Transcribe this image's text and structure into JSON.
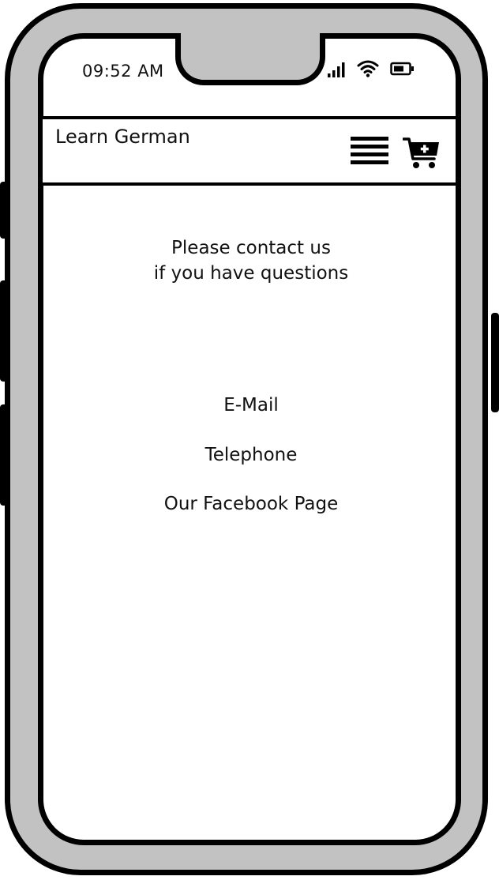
{
  "status_bar": {
    "time": "09:52 AM",
    "icons": [
      "signal-icon",
      "wifi-icon",
      "battery-icon"
    ]
  },
  "header": {
    "title": "Learn German",
    "menu_icon": "hamburger-menu-icon",
    "cart_icon": "add-to-cart-icon"
  },
  "contact": {
    "intro_line1": "Please contact us",
    "intro_line2": "if you have questions",
    "links": {
      "email": "E-Mail",
      "telephone": "Telephone",
      "facebook": "Our Facebook Page"
    }
  },
  "colors": {
    "frame": "#c2c2c2",
    "outline": "#000000",
    "screen": "#ffffff"
  }
}
